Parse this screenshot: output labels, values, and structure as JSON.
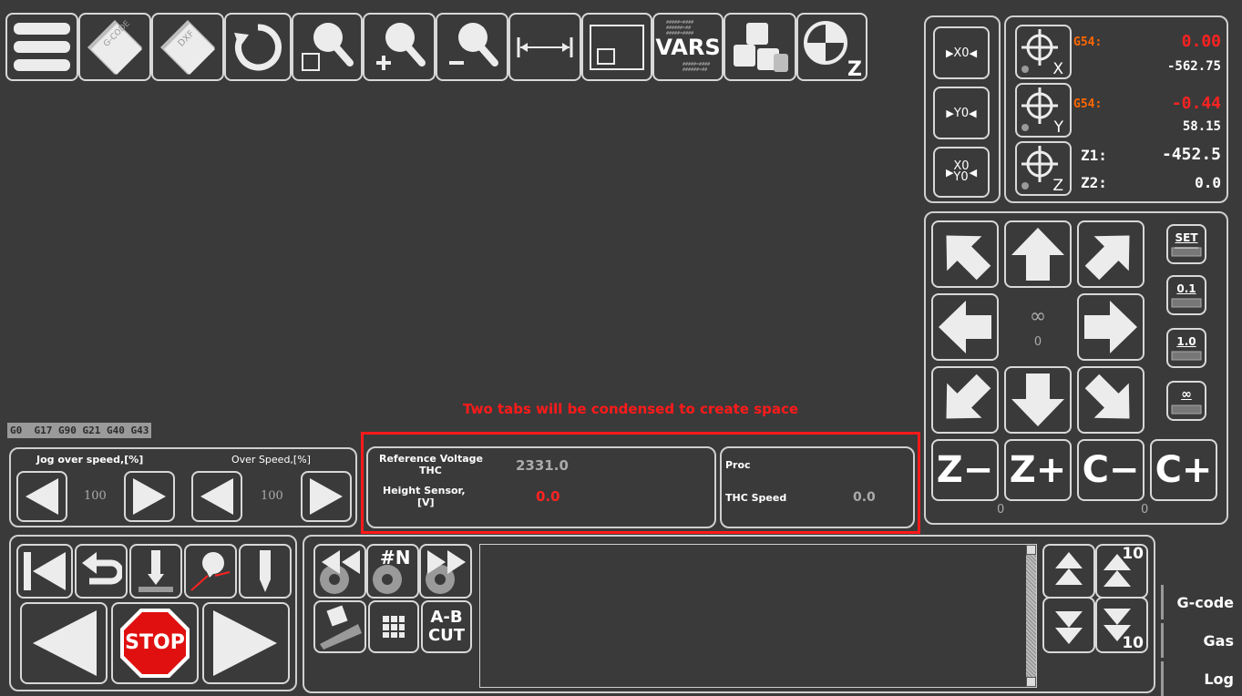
{
  "toolbar": {
    "vars_label": "VARS",
    "zoom_z_label": "Z"
  },
  "gcode_status": "G0  G17 G90 G21 G40 G43",
  "annotation": "Two tabs will be condensed to create space",
  "jog": {
    "jog_over_speed_label": "Jog over speed,[%]",
    "jog_over_speed_value": "100",
    "over_speed_label": "Over Speed,[%]",
    "over_speed_value": "100"
  },
  "thc": {
    "ref_voltage_label": "Reference Voltage",
    "ref_voltage_sub": "THC",
    "ref_voltage_value": "2331.0",
    "height_sensor_label": "Height Sensor,",
    "height_sensor_sub": "[V]",
    "height_sensor_value": "0.0",
    "proc_label": "Proc",
    "thc_speed_label": "THC Speed",
    "thc_speed_value": "0.0"
  },
  "zero_buttons": {
    "x0": "X0",
    "y0": "Y0",
    "xy0_top": "X0",
    "xy0_bottom": "Y0"
  },
  "dro": {
    "x": {
      "axis": "X",
      "offset_label": "G54:",
      "offset_value": "0.00",
      "machine_value": "-562.75"
    },
    "y": {
      "axis": "Y",
      "offset_label": "G54:",
      "offset_value": "-0.44",
      "machine_value": "58.15"
    },
    "z": {
      "axis": "Z",
      "z1_label": "Z1:",
      "z1_value": "-452.5",
      "z2_label": "Z2:",
      "z2_value": "0.0"
    }
  },
  "jogpad": {
    "center_symbol": "∞",
    "center_value": "0",
    "step_set": "SET",
    "step_01": "0.1",
    "step_10": "1.0",
    "step_inf": "∞",
    "z_minus": "Z−",
    "z_plus": "Z+",
    "c_minus": "C−",
    "c_plus": "C+",
    "z_value": "0",
    "c_value": "0"
  },
  "run": {
    "stop_label": "STOP"
  },
  "program": {
    "goto_line_label": "#N",
    "ab_cut_top": "A-B",
    "ab_cut_bottom": "CUT",
    "scroll_up_10": "10",
    "scroll_down_10": "10"
  },
  "side_tabs": [
    "G-code",
    "Gas",
    "Log"
  ],
  "colors": {
    "background": "#3a3a3a",
    "icon": "#ececec",
    "g54_orange": "#ff6600",
    "value_red": "#ff2222",
    "annotation_red": "#ff1a1a",
    "stop_red": "#e01010"
  }
}
